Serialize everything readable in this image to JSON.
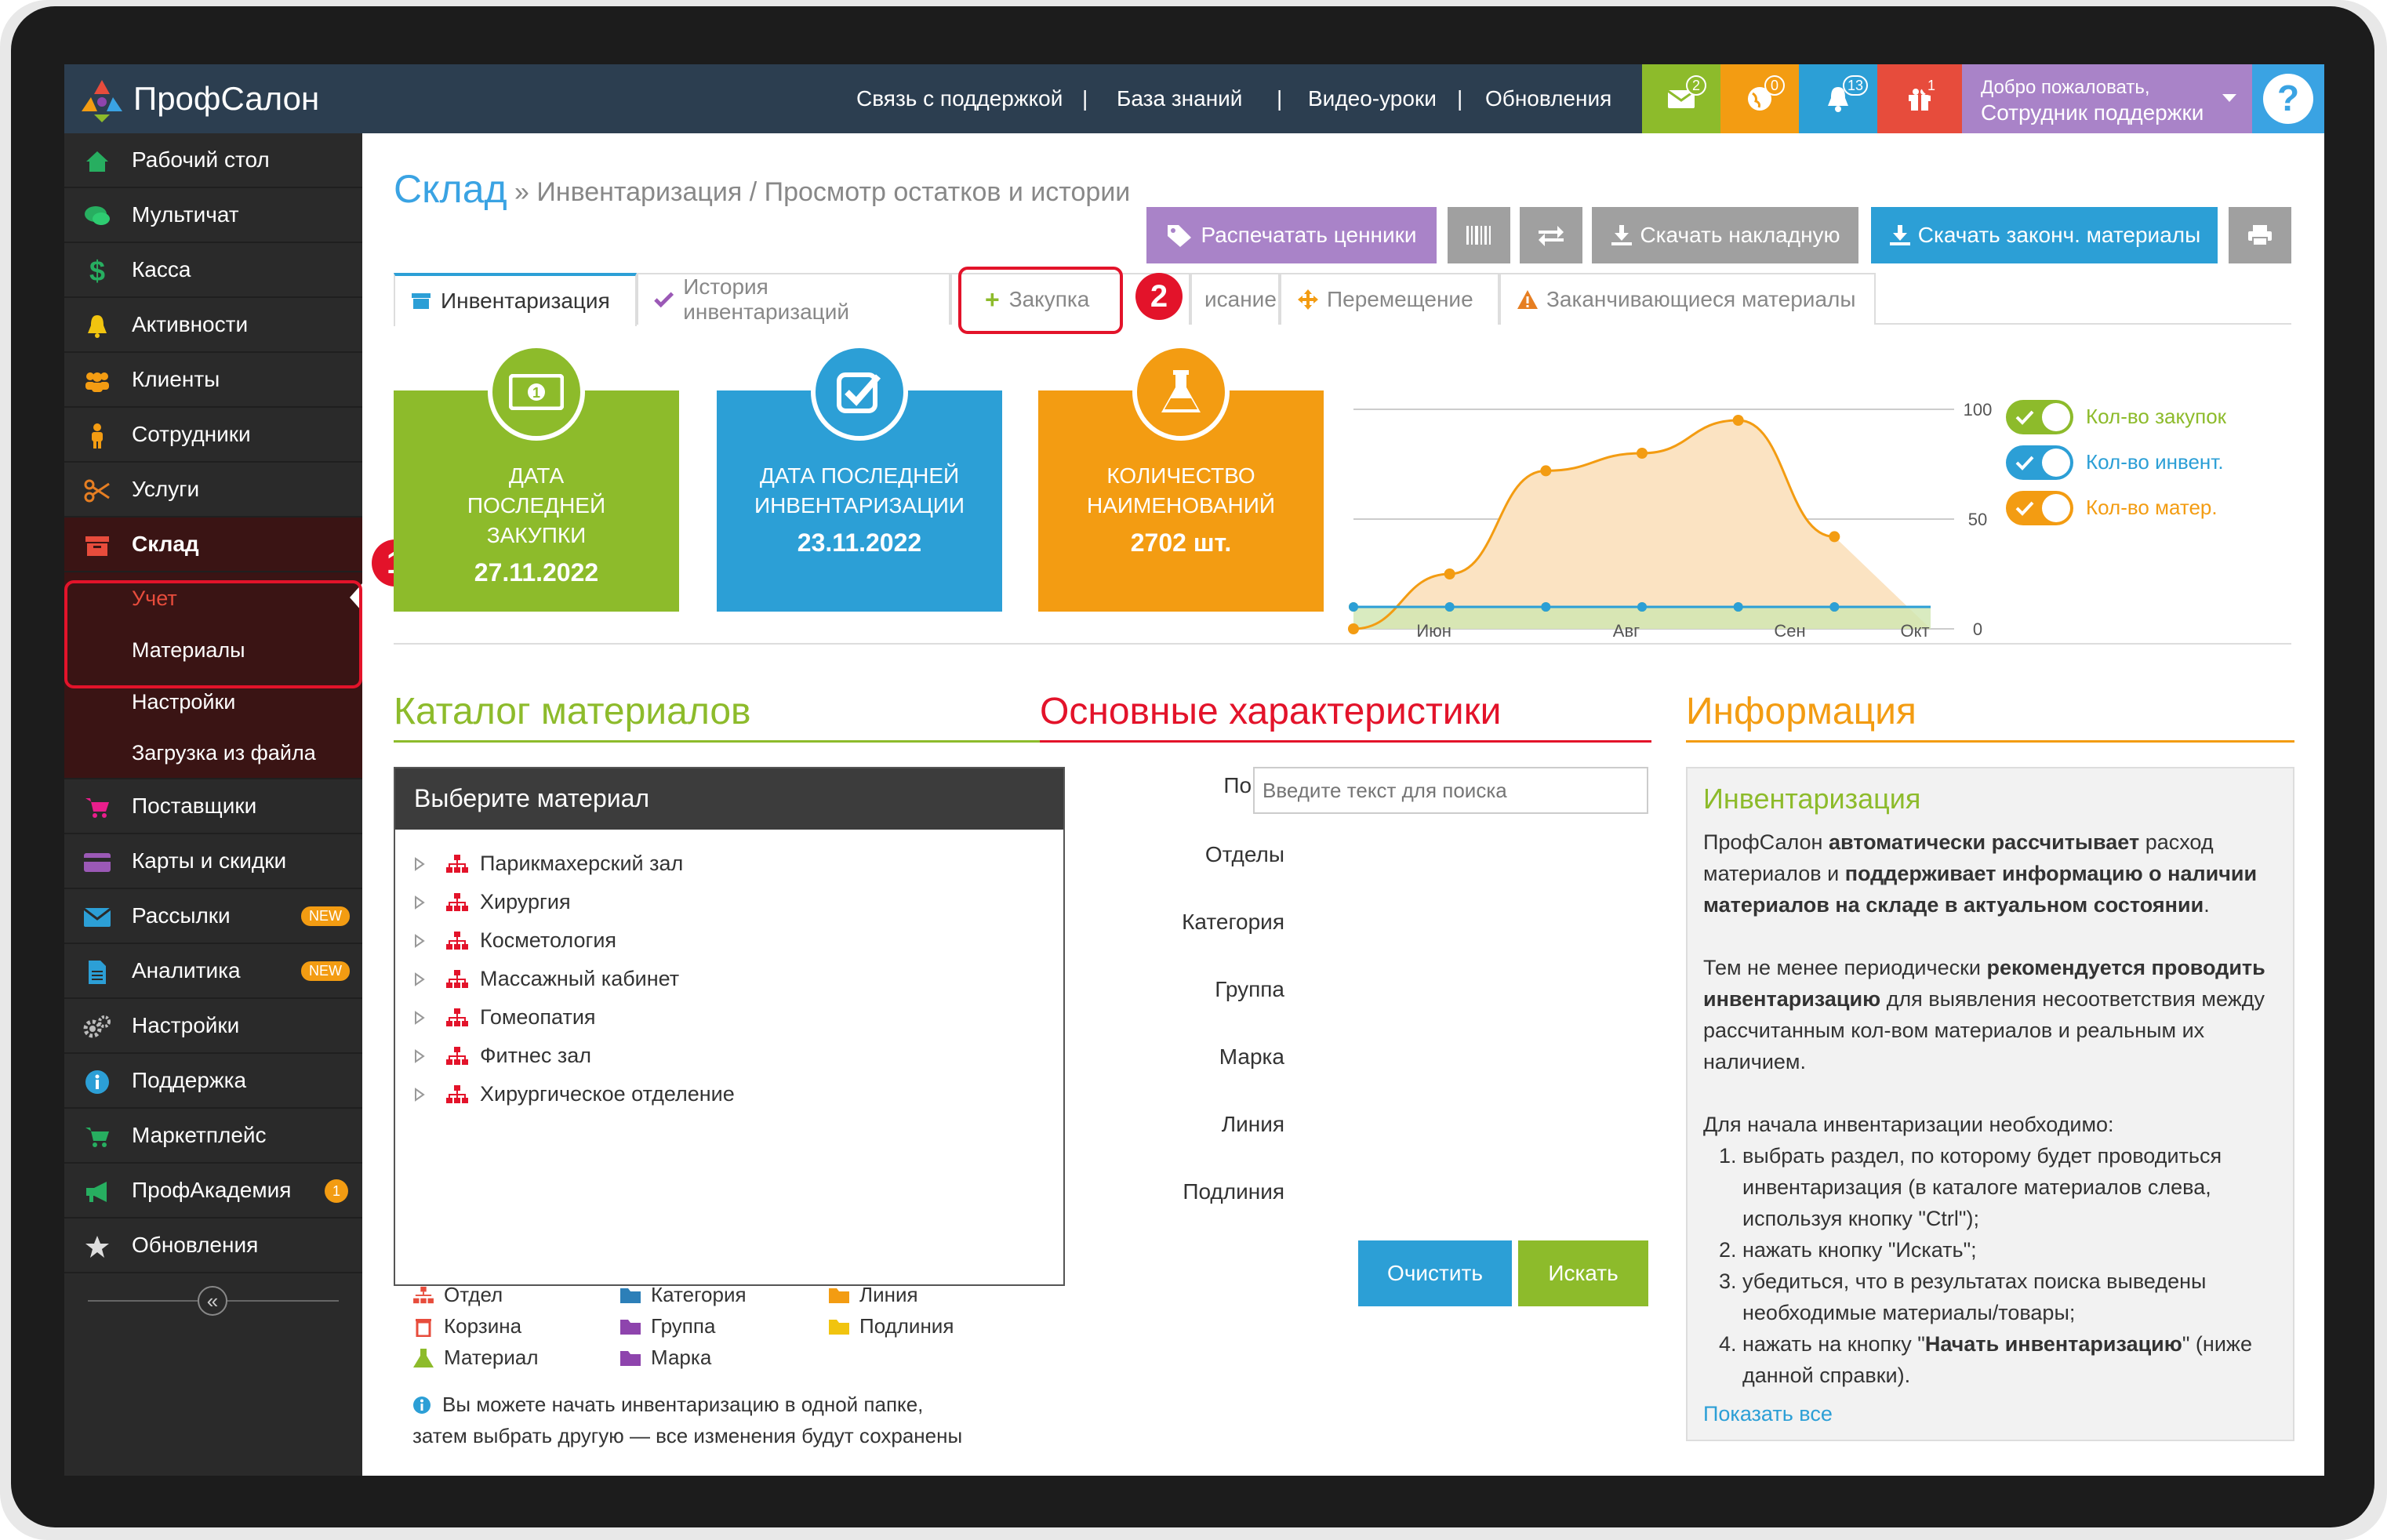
{
  "app": {
    "brand": "ПрофСалон"
  },
  "topbar": {
    "links": [
      "Связь с поддержкой",
      "База знаний",
      "Видео-уроки",
      "Обновления"
    ],
    "separator": "|",
    "badges": {
      "messages": "2",
      "orders": "0",
      "notifications": "13",
      "gifts": "1"
    },
    "welcome_line1": "Добро пожаловать,",
    "welcome_line2": "Сотрудник поддержки"
  },
  "sidebar": {
    "items": [
      {
        "label": "Рабочий стол",
        "icon": "home-icon"
      },
      {
        "label": "Мультичат",
        "icon": "chat-icon"
      },
      {
        "label": "Касса",
        "icon": "dollar-icon"
      },
      {
        "label": "Активности",
        "icon": "bell-icon"
      },
      {
        "label": "Клиенты",
        "icon": "users-icon"
      },
      {
        "label": "Сотрудники",
        "icon": "person-icon"
      },
      {
        "label": "Услуги",
        "icon": "scissors-icon"
      },
      {
        "label": "Склад",
        "icon": "archive-icon"
      }
    ],
    "warehouse_sub": [
      "Учет",
      "Материалы",
      "Настройки",
      "Загрузка из файла"
    ],
    "items2": [
      {
        "label": "Поставщики",
        "icon": "cart-icon"
      },
      {
        "label": "Карты и скидки",
        "icon": "card-icon"
      },
      {
        "label": "Рассылки",
        "icon": "mail-icon",
        "badge": "NEW"
      },
      {
        "label": "Аналитика",
        "icon": "file-icon",
        "badge": "NEW"
      },
      {
        "label": "Настройки",
        "icon": "gears-icon"
      },
      {
        "label": "Поддержка",
        "icon": "info-icon"
      },
      {
        "label": "Маркетплейс",
        "icon": "cart-icon"
      },
      {
        "label": "ПрофАкадемия",
        "icon": "megaphone-icon",
        "badge": "1"
      },
      {
        "label": "Обновления",
        "icon": "star-icon"
      }
    ],
    "collapse": "«"
  },
  "page": {
    "title": "Склад",
    "breadcrumb": "» Инвентаризация / Просмотр остатков и истории"
  },
  "toolbar": {
    "print_tags": "Распечатать ценники",
    "download_invoice": "Скачать накладную",
    "download_ending": "Скачать законч. материалы"
  },
  "tabs": [
    "Инвентаризация",
    "История инвентаризаций",
    "Закупка",
    "Списание",
    "Перемещение",
    "Заканчивающиеся материалы"
  ],
  "tab_visible": {
    "write_off": "исание"
  },
  "callouts": {
    "one": "1",
    "two": "2"
  },
  "cards": [
    {
      "title": "ДАТА ПОСЛЕДНЕЙ ЗАКУПКИ",
      "value": "27.11.2022",
      "color": "#8dbb2b"
    },
    {
      "title": "ДАТА ПОСЛЕДНЕЙ ИНВЕНТАРИЗАЦИИ",
      "value": "23.11.2022",
      "color": "#2c9fd6"
    },
    {
      "title": "КОЛИЧЕСТВО НАИМЕНОВАНИЙ",
      "value": "2702 шт.",
      "color": "#f39c12"
    }
  ],
  "chart_data": {
    "type": "area",
    "x": [
      0,
      1,
      2,
      3,
      4,
      5,
      6
    ],
    "xtick_labels": [
      "Июн",
      "Авг",
      "Сен",
      "Окт"
    ],
    "ylim": [
      0,
      100
    ],
    "yticks": [
      "100",
      "50",
      "0"
    ],
    "series": [
      {
        "name": "Кол-во закупок",
        "color": "#8dbb2b",
        "values": [
          10,
          10,
          10,
          10,
          10,
          10
        ]
      },
      {
        "name": "Кол-во инвент.",
        "color": "#2c9fd6",
        "values": [
          10,
          10,
          10,
          10,
          10,
          10
        ]
      },
      {
        "name": "Кол-во матер.",
        "color": "#f39c12",
        "values": [
          0,
          25,
          72,
          80,
          95,
          42
        ]
      }
    ]
  },
  "catalog": {
    "heading": "Каталог материалов",
    "box_title": "Выберите материал",
    "tree": [
      "Парикмахерский зал",
      "Хирургия",
      "Косметология",
      "Массажный кабинет",
      "Гомеопатия",
      "Фитнес зал",
      "Хирургическое отделение"
    ],
    "legend": [
      {
        "label": "Отдел",
        "color": "#e74c3c"
      },
      {
        "label": "Категория",
        "color": "#2c7fb8"
      },
      {
        "label": "Линия",
        "color": "#f39c12"
      },
      {
        "label": "Корзина",
        "color": "#e74c3c"
      },
      {
        "label": "Группа",
        "color": "#8e44ad"
      },
      {
        "label": "Подлиния",
        "color": "#f1c40f"
      },
      {
        "label": "Материал",
        "color": "#8dbb2b"
      },
      {
        "label": "Марка",
        "color": "#8e44ad"
      }
    ],
    "note1": "Вы можете начать инвентаризацию в одной папке,",
    "note2": "затем выбрать другую — все изменения будут сохранены"
  },
  "main_chars": {
    "heading": "Основные характеристики",
    "search_label": "Поиск",
    "search_placeholder": "Введите текст для поиска",
    "fields": [
      "Отделы",
      "Категория",
      "Группа",
      "Марка",
      "Линия",
      "Подлиния"
    ],
    "clear": "Очистить",
    "search": "Искать"
  },
  "info": {
    "heading": "Информация",
    "box_title": "Инвентаризация",
    "p1a": "ПрофСалон ",
    "p1b": "автоматически рассчитывает",
    "p1c": " расход материалов и ",
    "p1d": "поддерживает информацию о наличии материалов на складе в актуальном состоянии",
    "p1e": ".",
    "p2a": "Тем не менее периодически ",
    "p2b": "рекомендуется проводить инвентаризацию",
    "p2c": " для выявления несоответствия между рассчитанным кол-вом материалов и реальным их наличием.",
    "p3": "Для начала инвентаризации необходимо:",
    "steps": [
      "выбрать раздел, по которому будет проводиться инвентаризация (в каталоге материалов слева, используя кнопку \"Ctrl\");",
      "нажать кнопку \"Искать\";",
      "убедиться, что в результатах поиска выведены необходимые материалы/товары;"
    ],
    "step4a": "нажать на кнопку \"",
    "step4b": "Начать инвентаризацию",
    "step4c": "\" (ниже данной справки).",
    "show_all": "Показать все"
  }
}
